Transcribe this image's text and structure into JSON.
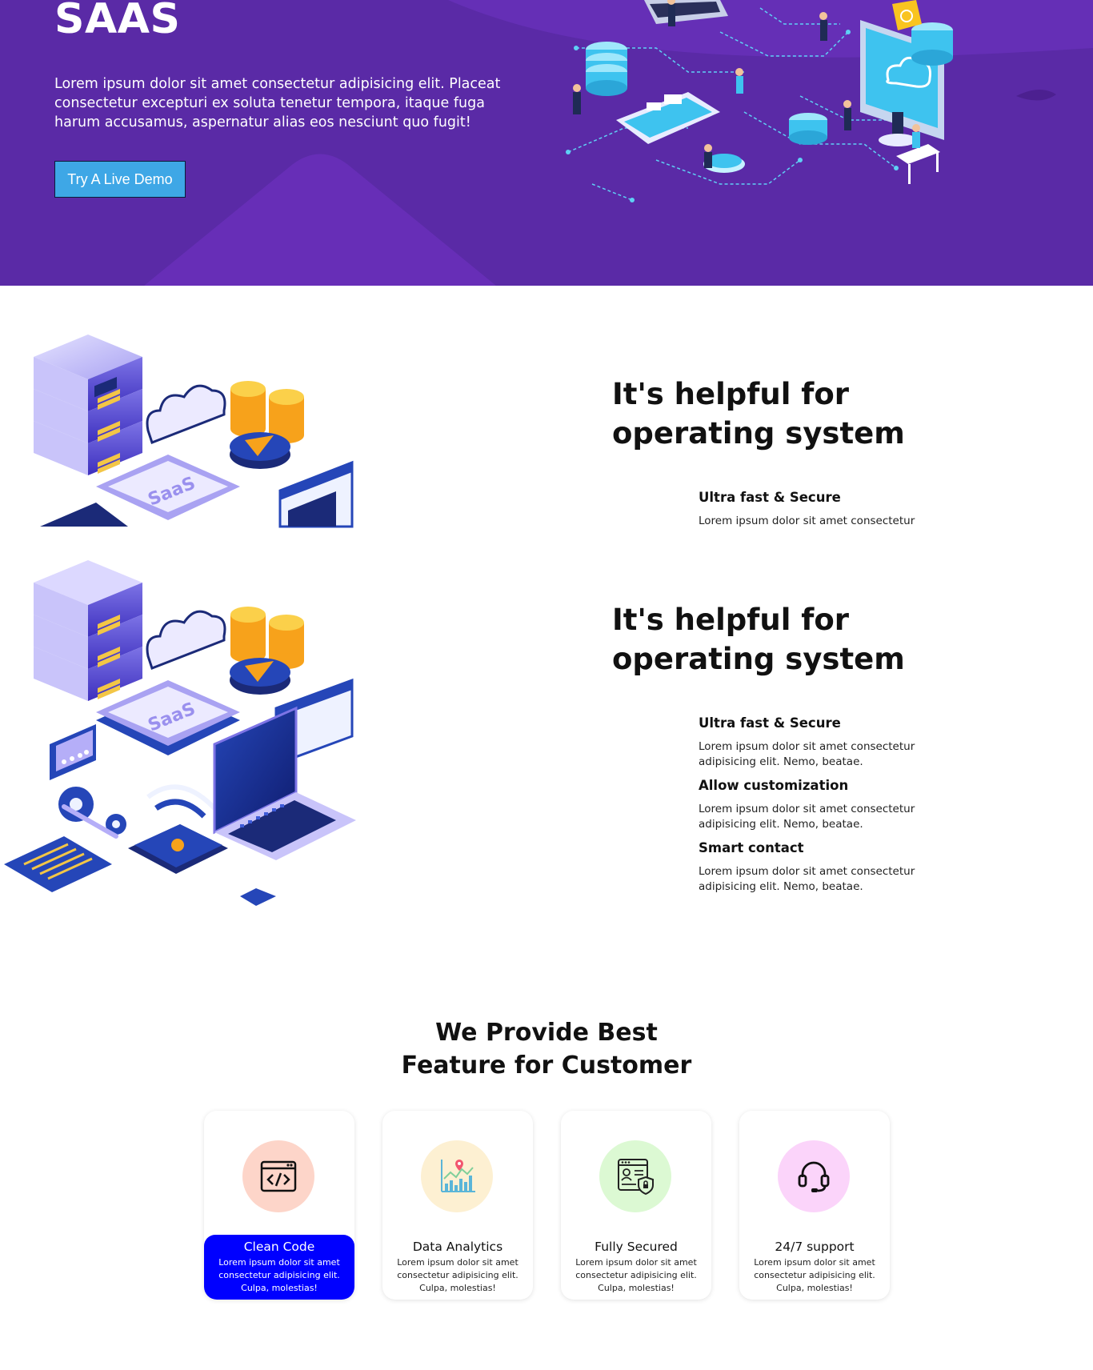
{
  "hero": {
    "title": "SAAS",
    "text": "Lorem ipsum dolor sit amet consectetur adipisicing elit. Placeat consectetur excepturi ex soluta tenetur tempora, itaque fuga harum accusamus, aspernatur alias eos nesciunt quo fugit!",
    "button_label": "Try A Live Demo",
    "colors": {
      "background": "#5a2aa6",
      "button": "#3ea7e6"
    }
  },
  "feature_rows": [
    {
      "heading": "It's helpful for operating system",
      "items": [
        {
          "title": "Ultra fast & Secure",
          "text": "Lorem ipsum dolor sit amet consectetur"
        }
      ]
    },
    {
      "heading": "It's helpful for operating system",
      "items": [
        {
          "title": "Ultra fast & Secure",
          "text": "Lorem ipsum dolor sit amet consectetur adipisicing elit. Nemo, beatae."
        },
        {
          "title": "Allow customization",
          "text": "Lorem ipsum dolor sit amet consectetur adipisicing elit. Nemo, beatae."
        },
        {
          "title": "Smart contact",
          "text": "Lorem ipsum dolor sit amet consectetur adipisicing elit. Nemo, beatae."
        }
      ]
    }
  ],
  "illustration_label": "SaaS",
  "services": {
    "title": "We Provide Best Feature for Customer",
    "cards": [
      {
        "title": "Clean Code",
        "text": "Lorem ipsum dolor sit amet consectetur adipisicing elit. Culpa, molestias!",
        "icon": "code-window-icon",
        "circle_color": "#fdd5c9",
        "active": true
      },
      {
        "title": "Data Analytics",
        "text": "Lorem ipsum dolor sit amet consectetur adipisicing elit. Culpa, molestias!",
        "icon": "analytics-chart-icon",
        "circle_color": "#fdf0d2",
        "active": false
      },
      {
        "title": "Fully Secured",
        "text": "Lorem ipsum dolor sit amet consectetur adipisicing elit. Culpa, molestias!",
        "icon": "secure-document-icon",
        "circle_color": "#dcf9d3",
        "active": false
      },
      {
        "title": "24/7 support",
        "text": "Lorem ipsum dolor sit amet consectetur adipisicing elit. Culpa, molestias!",
        "icon": "headset-icon",
        "circle_color": "#fbd4fa",
        "active": false
      }
    ],
    "active_color": "#0000ff"
  }
}
